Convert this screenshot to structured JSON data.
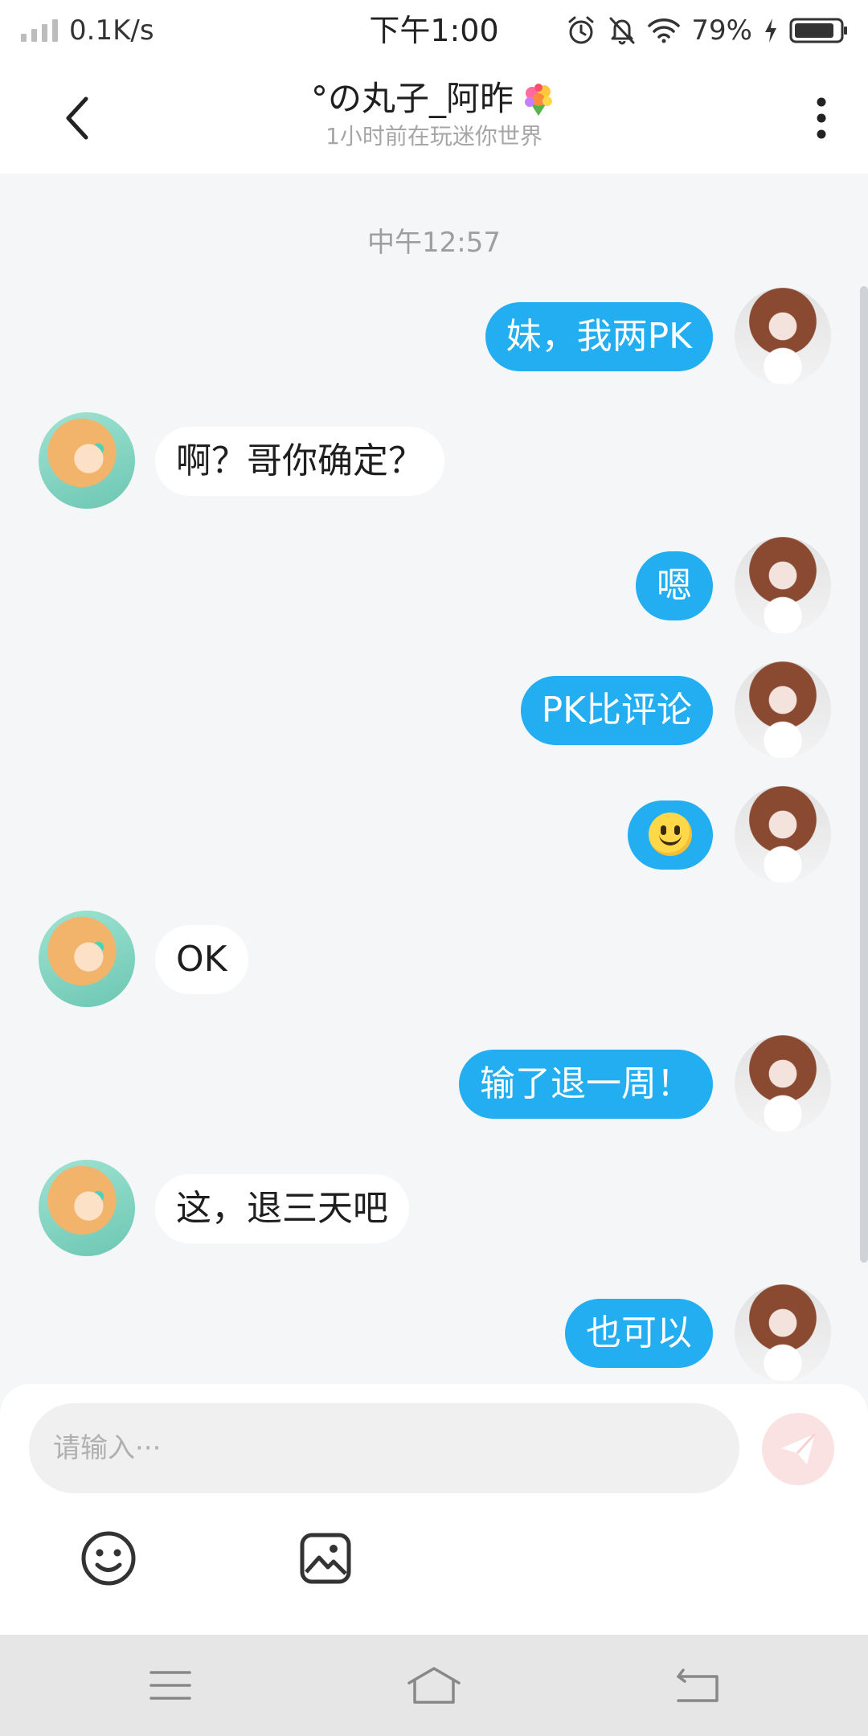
{
  "status_bar": {
    "speed": "0.1K/s",
    "time": "下午1:00",
    "battery": "79%"
  },
  "header": {
    "title": "°の丸子_阿昨",
    "subtitle": "1小时前在玩迷你世界"
  },
  "chat": {
    "timestamp": "中午12:57",
    "messages": [
      {
        "from": "me",
        "text": "妹，我两PK"
      },
      {
        "from": "them",
        "text": "啊？哥你确定？"
      },
      {
        "from": "me",
        "text": "嗯"
      },
      {
        "from": "me",
        "text": "PK比评论"
      },
      {
        "from": "me",
        "emoji": "slightly-smiling-face"
      },
      {
        "from": "them",
        "text": "OK"
      },
      {
        "from": "me",
        "text": "输了退一周！"
      },
      {
        "from": "them",
        "text": "这，退三天吧"
      },
      {
        "from": "me",
        "text": "也可以"
      }
    ]
  },
  "input": {
    "placeholder": "请输入···"
  },
  "colors": {
    "accent": "#22aef0",
    "background": "#f4f6f8",
    "send_button": "#fbe2e2"
  },
  "icons": {
    "back": "chevron-left-icon",
    "more": "more-vertical-icon",
    "send": "paper-plane-icon",
    "emoji": "smiley-icon",
    "image": "image-icon",
    "nav_menu": "menu-icon",
    "nav_home": "home-icon",
    "nav_back": "back-arrow-icon"
  }
}
